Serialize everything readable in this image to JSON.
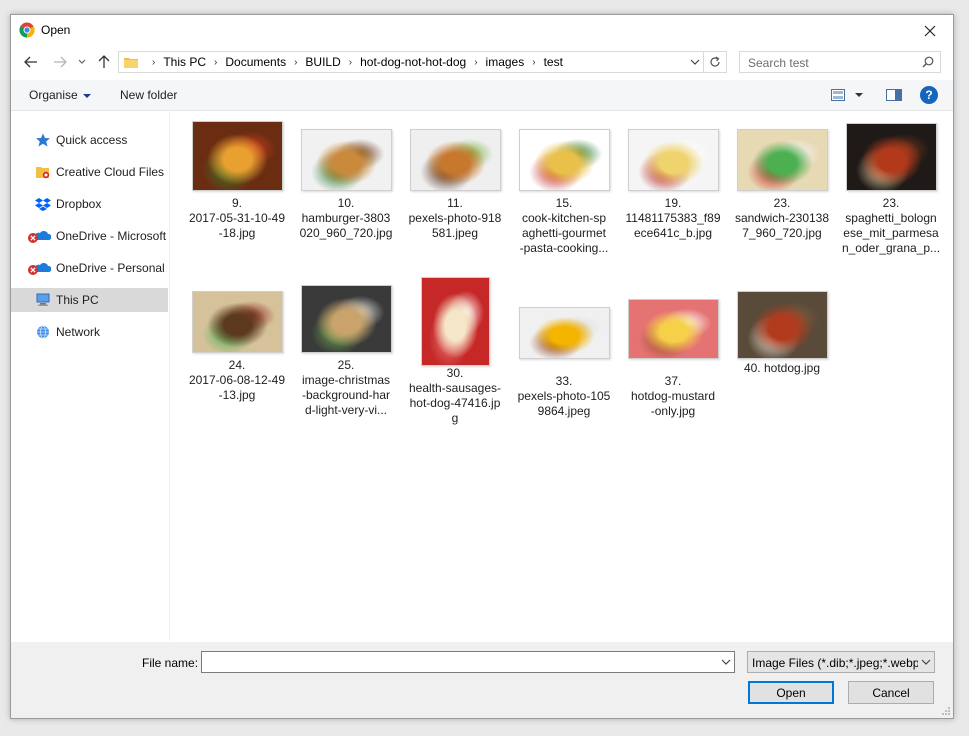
{
  "window": {
    "title": "Open",
    "close_label": "✕"
  },
  "nav": {
    "back_label": "←",
    "forward_label": "→",
    "recent_label": "˅",
    "up_label": "↑",
    "breadcrumbs": [
      "This PC",
      "Documents",
      "BUILD",
      "hot-dog-not-hot-dog",
      "images",
      "test"
    ],
    "search_placeholder": "Search test"
  },
  "toolbar": {
    "organise_label": "Organise",
    "new_folder_label": "New folder",
    "help_label": "?"
  },
  "sidebar": {
    "items": [
      {
        "label": "Quick access",
        "icon": "star-icon"
      },
      {
        "label": "Creative Cloud Files",
        "icon": "creative-cloud-folder-icon"
      },
      {
        "label": "Dropbox",
        "icon": "dropbox-icon"
      },
      {
        "label": "OneDrive - Microsoft",
        "icon": "onedrive-error-icon"
      },
      {
        "label": "OneDrive - Personal",
        "icon": "onedrive-error-icon"
      },
      {
        "label": "This PC",
        "icon": "computer-icon",
        "selected": true
      },
      {
        "label": "Network",
        "icon": "network-icon"
      }
    ]
  },
  "files": [
    {
      "name": "9.\n2017-05-31-10-49\n-18.jpg",
      "colors": [
        "#6b2d12",
        "#e8a030",
        "#3c7a2a",
        "#d43f22"
      ]
    },
    {
      "name": "10.\nhamburger-3803\n020_960_720.jpg",
      "colors": [
        "#f1f1f1",
        "#c98a3c",
        "#2e7d32",
        "#6a3c1f"
      ]
    },
    {
      "name": "11.\npexels-photo-918\n581.jpeg",
      "colors": [
        "#efefef",
        "#c8782d",
        "#4e2a17",
        "#7cb342"
      ]
    },
    {
      "name": "15.\ncook-kitchen-sp\naghetti-gourmet\n-pasta-cooking...",
      "colors": [
        "#ffffff",
        "#e9c14a",
        "#c62828",
        "#2e7d32"
      ]
    },
    {
      "name": "19.\n11481175383_f89\nece641c_b.jpg",
      "colors": [
        "#f5f5f5",
        "#efd36c",
        "#b71c1c",
        "#ffffff"
      ]
    },
    {
      "name": "23.\nsandwich-230138\n7_960_720.jpg",
      "colors": [
        "#e8d9b5",
        "#4caf50",
        "#c62828",
        "#f5f5f5"
      ]
    },
    {
      "name": "23.\nspaghetti_bologn\nese_mit_parmesa\nn_oder_grana_p...",
      "colors": [
        "#1f1a17",
        "#b3391b",
        "#e8d3a3",
        "#7a3418"
      ]
    },
    {
      "name": "24.\n2017-06-08-12-49\n-13.jpg",
      "colors": [
        "#d6c29a",
        "#5d3a1f",
        "#4caf50",
        "#8d2b1e"
      ]
    },
    {
      "name": "25.\nimage-christmas\n-background-har\nd-light-very-vi...",
      "colors": [
        "#3a3a3a",
        "#c9a36b",
        "#6aa84f",
        "#e0e0e0"
      ]
    },
    {
      "name": "30.\nhealth-sausages-\nhot-dog-47416.jp\ng",
      "colors": [
        "#c62828",
        "#f5e6c8",
        "#e57373",
        "#ffffff"
      ]
    },
    {
      "name": "33.\npexels-photo-105\n9864.jpeg",
      "colors": [
        "#f0f0f0",
        "#f4b400",
        "#8d3b1b",
        "#dcdcdc"
      ]
    },
    {
      "name": "37.\nhotdog-mustard\n-only.jpg",
      "colors": [
        "#e57373",
        "#f7d04a",
        "#a0522d",
        "#ffffff"
      ]
    },
    {
      "name": "40. hotdog.jpg",
      "colors": [
        "#5a4a3a",
        "#b23a1d",
        "#e9e2d2",
        "#7a5c3c"
      ]
    }
  ],
  "footer": {
    "filename_label": "File name:",
    "filename_value": "",
    "filter_label": "Image Files (*.dib;*.jpeg;*.webp",
    "open_label": "Open",
    "cancel_label": "Cancel"
  }
}
